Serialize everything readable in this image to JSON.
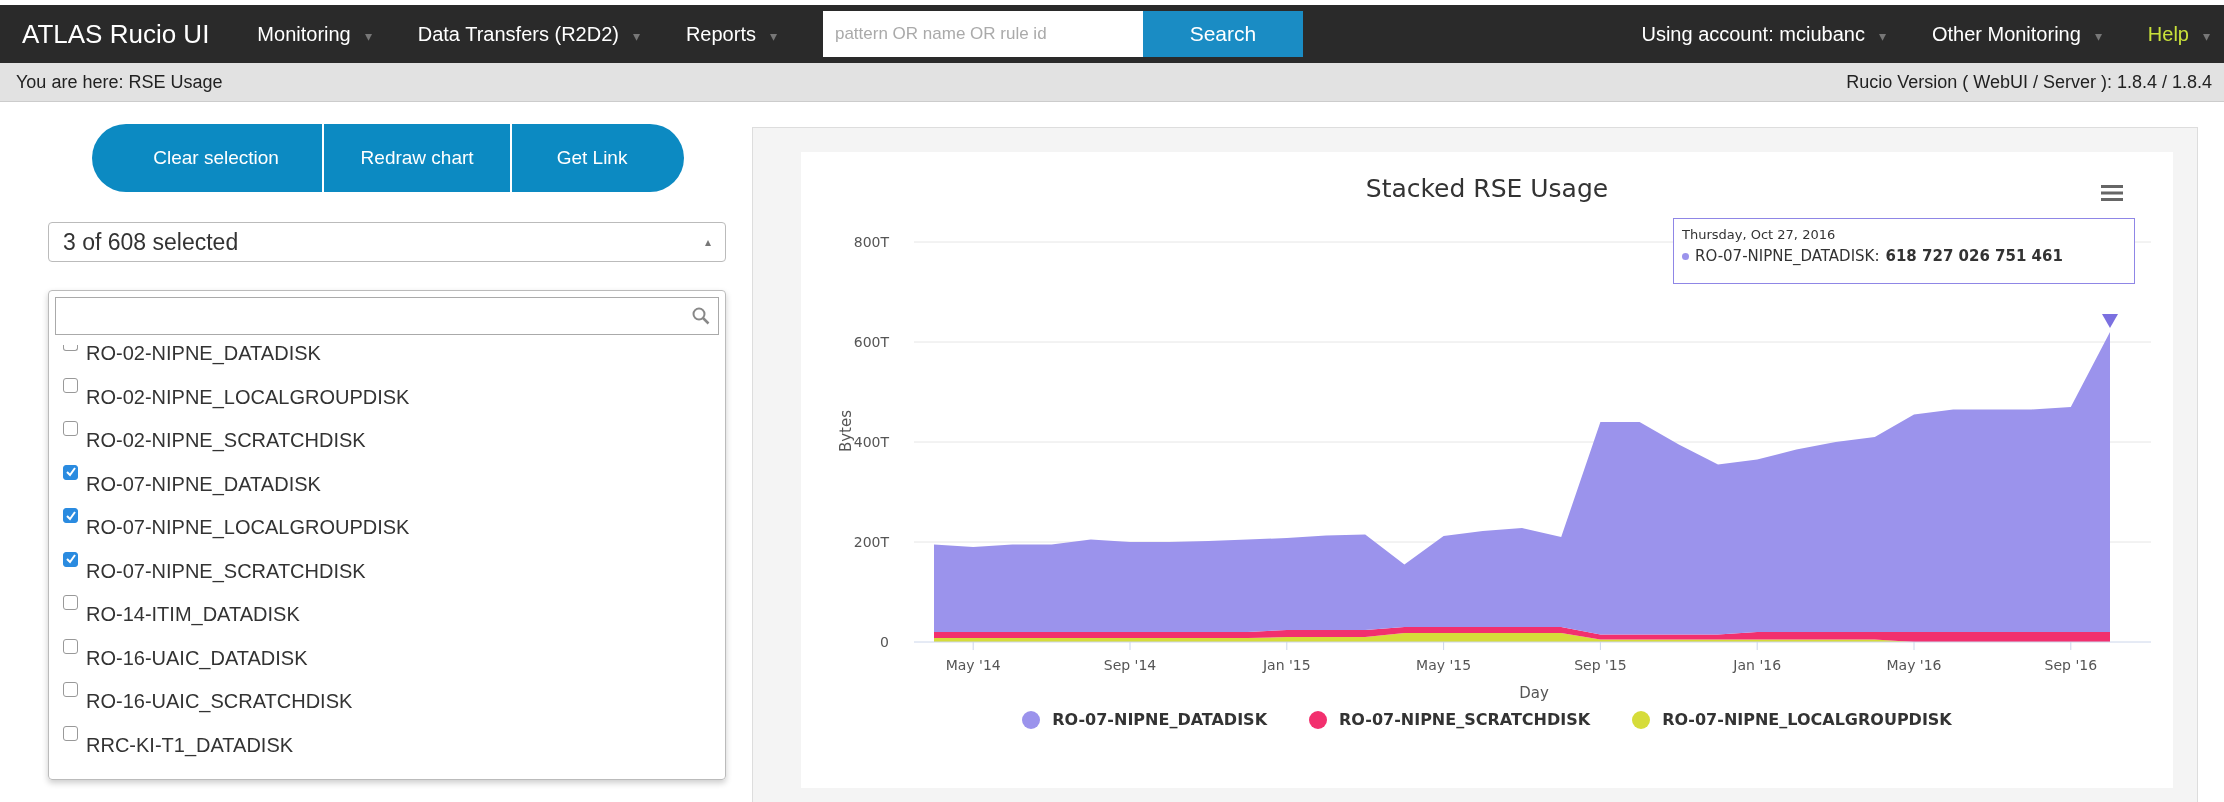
{
  "navbar": {
    "brand": "ATLAS Rucio UI",
    "menus": [
      {
        "label": "Monitoring",
        "caret": "▾"
      },
      {
        "label": "Data Transfers (R2D2)",
        "caret": "▾"
      },
      {
        "label": "Reports",
        "caret": "▾"
      }
    ],
    "search": {
      "placeholder": "pattern OR name OR rule id",
      "button": "Search"
    },
    "right_menus": [
      {
        "label": "Using account: mciubanc",
        "caret": "▾",
        "kind": "menu"
      },
      {
        "label": "Other Monitoring",
        "caret": "▾",
        "kind": "menu"
      },
      {
        "label": "Help",
        "caret": "▾",
        "kind": "help"
      }
    ]
  },
  "breadcrumb": {
    "text": "You are here: RSE Usage",
    "version": "Rucio Version ( WebUI / Server ): 1.8.4 / 1.8.4"
  },
  "actions": [
    "Clear selection",
    "Redraw chart",
    "Get Link"
  ],
  "select": {
    "value": "3 of 608 selected",
    "caret": "▴"
  },
  "rse_list": [
    {
      "label": "RO-02-NIPNE_DATADISK",
      "checked": false
    },
    {
      "label": "RO-02-NIPNE_LOCALGROUPDISK",
      "checked": false
    },
    {
      "label": "RO-02-NIPNE_SCRATCHDISK",
      "checked": false
    },
    {
      "label": "RO-07-NIPNE_DATADISK",
      "checked": true
    },
    {
      "label": "RO-07-NIPNE_LOCALGROUPDISK",
      "checked": true
    },
    {
      "label": "RO-07-NIPNE_SCRATCHDISK",
      "checked": true
    },
    {
      "label": "RO-14-ITIM_DATADISK",
      "checked": false
    },
    {
      "label": "RO-16-UAIC_DATADISK",
      "checked": false
    },
    {
      "label": "RO-16-UAIC_SCRATCHDISK",
      "checked": false
    },
    {
      "label": "RRC-KI-T1_DATADISK",
      "checked": false
    }
  ],
  "chart": {
    "tooltip": {
      "date": "Thursday, Oct 27, 2016",
      "series": "RO-07-NIPNE_DATADISK:",
      "value": "618 727 026 751 461"
    },
    "chart_data": {
      "type": "area",
      "stacked": true,
      "title": "Stacked RSE Usage",
      "xlabel": "Day",
      "ylabel": "Bytes",
      "categories": [
        null,
        "May '14",
        null,
        null,
        null,
        "Sep '14",
        null,
        null,
        null,
        "Jan '15",
        null,
        null,
        null,
        "May '15",
        null,
        null,
        null,
        "Sep '15",
        null,
        null,
        null,
        "Jan '16",
        null,
        null,
        null,
        "May '16",
        null,
        null,
        null,
        "Sep '16",
        null
      ],
      "ylim": [
        0,
        800
      ],
      "grid": true,
      "yticks": [
        {
          "value": 0,
          "label": "0"
        },
        {
          "value": 200,
          "label": "200T"
        },
        {
          "value": 400,
          "label": "400T"
        },
        {
          "value": 600,
          "label": "600T"
        },
        {
          "value": 800,
          "label": "800T"
        }
      ],
      "series": [
        {
          "name": "RO-07-NIPNE_DATADISK",
          "color": "#9b93ec",
          "values": [
            175,
            170,
            175,
            175,
            185,
            180,
            180,
            182,
            185,
            184,
            189,
            191,
            125,
            182,
            192,
            198,
            180,
            425,
            425,
            380,
            340,
            345,
            365,
            380,
            390,
            435,
            445,
            445,
            445,
            450,
            600
          ]
        },
        {
          "name": "RO-07-NIPNE_SCRATCHDISK",
          "color": "#f2306e",
          "values": [
            12,
            12,
            12,
            12,
            12,
            12,
            12,
            12,
            12,
            14,
            14,
            14,
            12,
            12,
            12,
            12,
            12,
            10,
            10,
            10,
            10,
            15,
            15,
            15,
            15,
            20,
            20,
            20,
            20,
            20,
            20
          ]
        },
        {
          "name": "RO-07-NIPNE_LOCALGROUPDISK",
          "color": "#d6dc3a",
          "values": [
            8,
            8,
            8,
            8,
            8,
            8,
            8,
            8,
            8,
            10,
            10,
            10,
            18,
            18,
            18,
            18,
            18,
            5,
            5,
            5,
            5,
            5,
            5,
            5,
            5,
            0,
            0,
            0,
            0,
            0,
            0
          ]
        }
      ]
    }
  }
}
